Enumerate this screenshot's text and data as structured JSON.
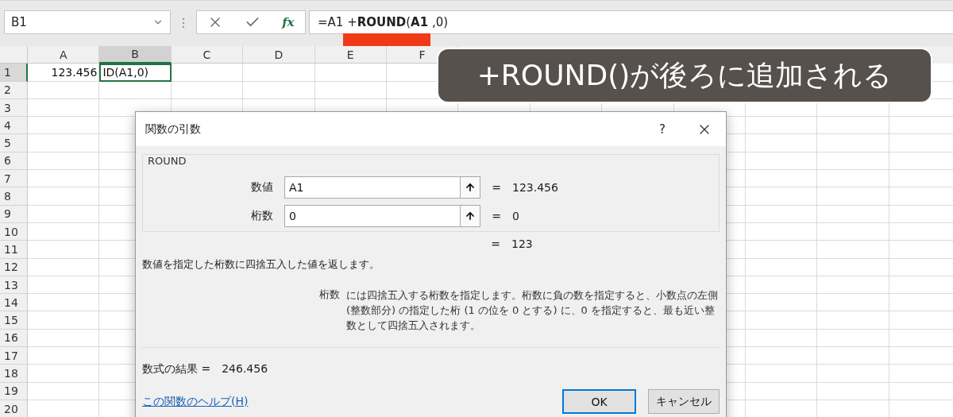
{
  "name_box": {
    "value": "B1"
  },
  "formula_bar": {
    "function_button": "fx",
    "formula": "=A1 +**ROUND**(**A1** ,0)"
  },
  "columns": [
    {
      "label": "A",
      "selected": false
    },
    {
      "label": "B",
      "selected": true
    },
    {
      "label": "C",
      "selected": false
    },
    {
      "label": "D",
      "selected": false
    },
    {
      "label": "E",
      "selected": false
    },
    {
      "label": "F",
      "selected": false
    }
  ],
  "rows": [
    {
      "label": "1",
      "selected": true,
      "cells": [
        {
          "text": "123.456",
          "active": false,
          "kind": "number"
        },
        {
          "text": "ID(A1,0)",
          "active": true,
          "kind": "text"
        }
      ]
    },
    {
      "label": "2",
      "selected": false
    },
    {
      "label": "3",
      "selected": false
    },
    {
      "label": "4",
      "selected": false
    },
    {
      "label": "5",
      "selected": false
    },
    {
      "label": "6",
      "selected": false
    },
    {
      "label": "7",
      "selected": false
    },
    {
      "label": "8",
      "selected": false
    },
    {
      "label": "9",
      "selected": false
    },
    {
      "label": "10",
      "selected": false
    },
    {
      "label": "11",
      "selected": false
    },
    {
      "label": "12",
      "selected": false
    },
    {
      "label": "13",
      "selected": false
    },
    {
      "label": "14",
      "selected": false
    },
    {
      "label": "15",
      "selected": false
    },
    {
      "label": "16",
      "selected": false
    },
    {
      "label": "17",
      "selected": false
    },
    {
      "label": "18",
      "selected": false
    },
    {
      "label": "19",
      "selected": false
    },
    {
      "label": "20",
      "selected": false
    }
  ],
  "caption": "+ROUND()が後ろに追加される",
  "dialog": {
    "title": "関数の引数",
    "help_button": "?",
    "group_title": "ROUND",
    "arguments": [
      {
        "label": "数値",
        "value": "A1",
        "equals": "=",
        "result": "123.456"
      },
      {
        "label": "桁数",
        "value": "0",
        "equals": "=",
        "result": "0"
      }
    ],
    "function_result": {
      "equals": "=",
      "result": "123"
    },
    "description": "数値を指定した桁数に四捨五入した値を返します。",
    "argument_help": {
      "name": "桁数",
      "text": "には四捨五入する桁数を指定します。桁数に負の数を指定すると、小数点の左側 (整数部分) の指定した桁 (1 の位を 0 とする) に、0 を指定すると、最も近い整数として四捨五入されます。"
    },
    "formula_result": {
      "label": "数式の結果 =",
      "value": "246.456"
    },
    "help_link": "この関数のヘルプ(H)",
    "buttons": [
      {
        "label": "OK",
        "default": true
      },
      {
        "label": "キャンセル",
        "default": false
      }
    ]
  }
}
